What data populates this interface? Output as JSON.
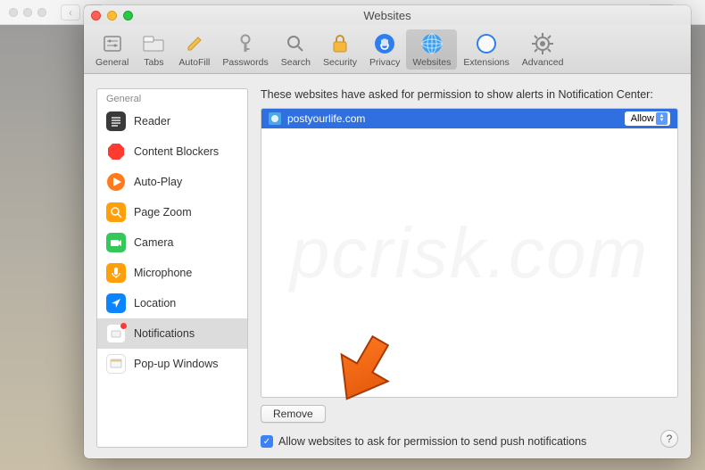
{
  "chrome": {
    "back": "‹",
    "forward": "›"
  },
  "window": {
    "title": "Websites"
  },
  "toolbar": {
    "items": [
      {
        "label": "General"
      },
      {
        "label": "Tabs"
      },
      {
        "label": "AutoFill"
      },
      {
        "label": "Passwords"
      },
      {
        "label": "Search"
      },
      {
        "label": "Security"
      },
      {
        "label": "Privacy"
      },
      {
        "label": "Websites"
      },
      {
        "label": "Extensions"
      },
      {
        "label": "Advanced"
      }
    ]
  },
  "sidebar": {
    "header": "General",
    "items": [
      {
        "label": "Reader"
      },
      {
        "label": "Content Blockers"
      },
      {
        "label": "Auto-Play"
      },
      {
        "label": "Page Zoom"
      },
      {
        "label": "Camera"
      },
      {
        "label": "Microphone"
      },
      {
        "label": "Location"
      },
      {
        "label": "Notifications"
      },
      {
        "label": "Pop-up Windows"
      }
    ]
  },
  "main": {
    "description": "These websites have asked for permission to show alerts in Notification Center:",
    "site": {
      "domain": "postyourlife.com",
      "permission": "Allow"
    },
    "remove_label": "Remove",
    "checkbox_label": "Allow websites to ask for permission to send push notifications"
  },
  "help": {
    "label": "?"
  }
}
